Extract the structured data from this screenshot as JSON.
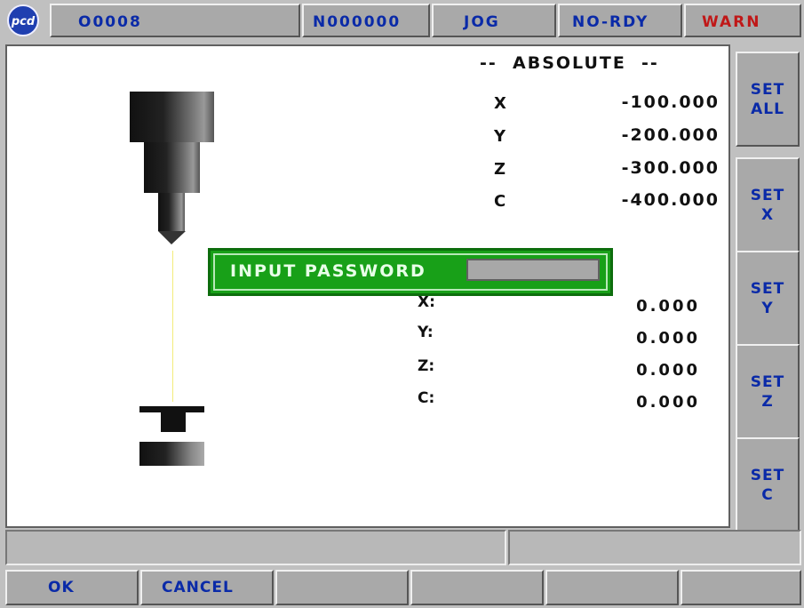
{
  "top_bar": {
    "logo_text": "pcd",
    "program": "O0008",
    "sequence": "N000000",
    "mode": "JOG",
    "ready_state": "NO-RDY",
    "warning": "WARN"
  },
  "absolute": {
    "title": "--  ABSOLUTE  --",
    "axes": [
      {
        "axis": "X",
        "value": "-100.000"
      },
      {
        "axis": "Y",
        "value": "-200.000"
      },
      {
        "axis": "Z",
        "value": "-300.000"
      },
      {
        "axis": "C",
        "value": "-400.000"
      }
    ]
  },
  "secondary": {
    "axes": [
      {
        "axis": "X:",
        "value": "0.000"
      },
      {
        "axis": "Y:",
        "value": "0.000"
      },
      {
        "axis": "Z:",
        "value": "0.000"
      },
      {
        "axis": "C:",
        "value": "0.000"
      }
    ]
  },
  "password_dialog": {
    "label": "INPUT PASSWORD",
    "value": ""
  },
  "right_keys": [
    {
      "line1": "SET",
      "line2": "ALL"
    },
    {
      "line1": "SET",
      "line2": "X"
    },
    {
      "line1": "SET",
      "line2": "Y"
    },
    {
      "line1": "SET",
      "line2": "Z"
    },
    {
      "line1": "SET",
      "line2": "C"
    }
  ],
  "message_bar": {
    "left": "",
    "right": ""
  },
  "bottom_keys": [
    "OK",
    "CANCEL",
    "",
    "",
    "",
    ""
  ],
  "colors": {
    "key_text": "#0a2aa8",
    "warn_text": "#c01818",
    "dialog_bg": "#18a018",
    "panel_bg": "#c0c0c0"
  }
}
